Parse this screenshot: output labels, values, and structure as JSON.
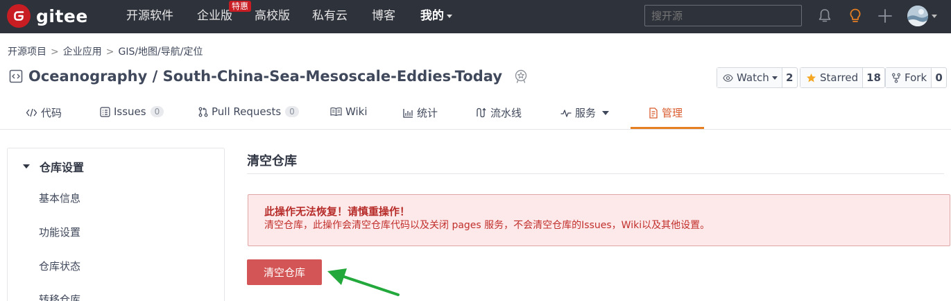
{
  "header": {
    "logo_text": "gitee",
    "nav": [
      "开源软件",
      "企业版",
      "高校版",
      "私有云",
      "博客",
      "我的"
    ],
    "enterprise_badge": "特惠",
    "search_placeholder": "搜开源",
    "icons": [
      "bell-icon",
      "lightbulb-icon",
      "plus-icon",
      "avatar"
    ]
  },
  "breadcrumb": [
    "开源项目",
    "企业应用",
    "GIS/地图/导航/定位"
  ],
  "repo": {
    "name": "Oceanography / South-China-Sea-Mesoscale-Eddies-Today",
    "watch_label": "Watch",
    "watch_count": "2",
    "star_label": "Starred",
    "star_count": "18",
    "fork_label": "Fork",
    "fork_count": "0"
  },
  "tabs": [
    {
      "label": "代码"
    },
    {
      "label": "Issues",
      "count": "0"
    },
    {
      "label": "Pull Requests",
      "count": "0"
    },
    {
      "label": "Wiki"
    },
    {
      "label": "统计"
    },
    {
      "label": "流水线"
    },
    {
      "label": "服务"
    },
    {
      "label": "管理",
      "active": true
    }
  ],
  "sidebar": {
    "section": "仓库设置",
    "items": [
      "基本信息",
      "功能设置",
      "仓库状态",
      "转移仓库"
    ]
  },
  "main": {
    "title": "清空仓库",
    "alert_title": "此操作无法恢复！请慎重操作！",
    "alert_body": "清空仓库，此操作会清空仓库代码以及关闭 pages 服务，不会清空仓库的Issues，Wiki以及其他设置。",
    "button": "清空仓库"
  },
  "colors": {
    "nav_bg": "#2e323b",
    "brand": "#c71d23",
    "accent": "#e67e22",
    "danger": "#d45555",
    "arrow": "#22a83b"
  }
}
